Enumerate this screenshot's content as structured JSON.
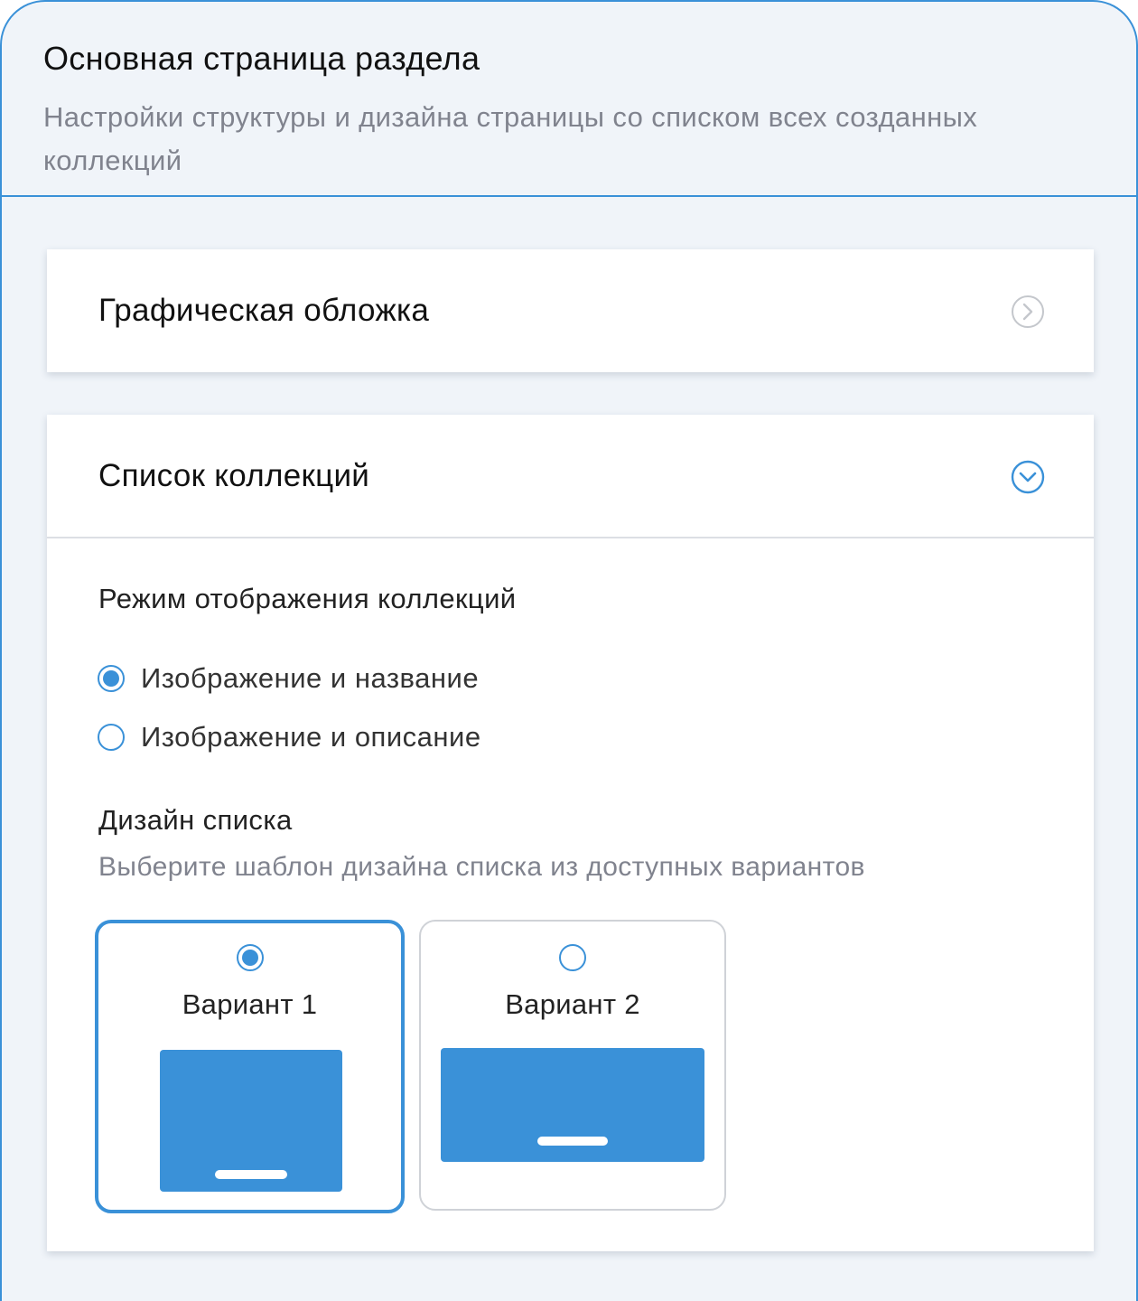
{
  "header": {
    "title": "Основная страница раздела",
    "description": "Настройки структуры и дизайна страницы со списком всех созданных коллекций"
  },
  "cover_section": {
    "title": "Графическая обложка",
    "state": "collapsed",
    "icon": "chevron-right-circle-icon"
  },
  "collections_section": {
    "title": "Список коллекций",
    "state": "expanded",
    "icon": "chevron-down-circle-icon",
    "display_mode": {
      "label": "Режим отображения коллекций",
      "options": [
        {
          "label": "Изображение и название",
          "selected": true
        },
        {
          "label": "Изображение и описание",
          "selected": false
        }
      ]
    },
    "design": {
      "label": "Дизайн списка",
      "hint": "Выберите шаблон дизайна списка из доступных вариантов",
      "variants": [
        {
          "label": "Вариант 1",
          "selected": true
        },
        {
          "label": "Вариант 2",
          "selected": false
        }
      ]
    }
  },
  "colors": {
    "accent": "#3a91d8",
    "panel_background": "#f0f4f9",
    "muted_text": "#80838e"
  }
}
